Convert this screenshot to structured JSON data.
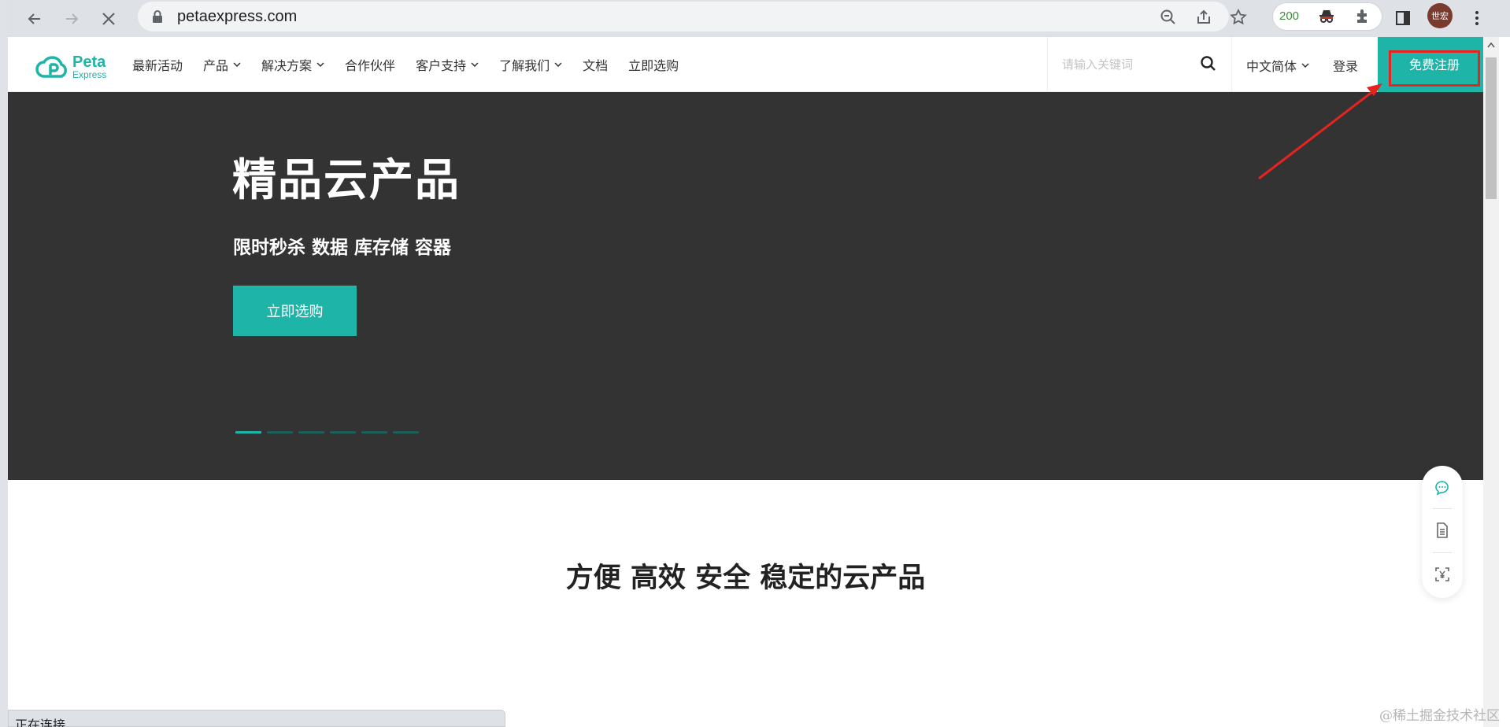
{
  "browser": {
    "url": "petaexpress.com",
    "extension_count": "200",
    "profile_initials": "世宏",
    "status_text": "正在连接..."
  },
  "header": {
    "logo": {
      "brand": "Peta",
      "sub": "Express"
    },
    "nav": [
      {
        "label": "最新活动",
        "dropdown": false
      },
      {
        "label": "产品",
        "dropdown": true
      },
      {
        "label": "解决方案",
        "dropdown": true
      },
      {
        "label": "合作伙伴",
        "dropdown": false
      },
      {
        "label": "客户支持",
        "dropdown": true
      },
      {
        "label": "了解我们",
        "dropdown": true
      },
      {
        "label": "文档",
        "dropdown": false
      },
      {
        "label": "立即选购",
        "dropdown": false
      }
    ],
    "search": {
      "placeholder": "请输入关键词"
    },
    "language": "中文简体",
    "login": "登录",
    "register": "免费注册"
  },
  "hero": {
    "title": "精品云产品",
    "subtitle": "限时秒杀 数据 库存储 容器",
    "cta": "立即选购",
    "slide_count": 6,
    "active_slide": 0
  },
  "section": {
    "title": "方便 高效 安全 稳定的云产品"
  },
  "watermark": "@稀土掘金技术社区",
  "colors": {
    "brand": "#1eb4a8",
    "hero_bg": "#333333",
    "highlight": "#e5231f"
  }
}
